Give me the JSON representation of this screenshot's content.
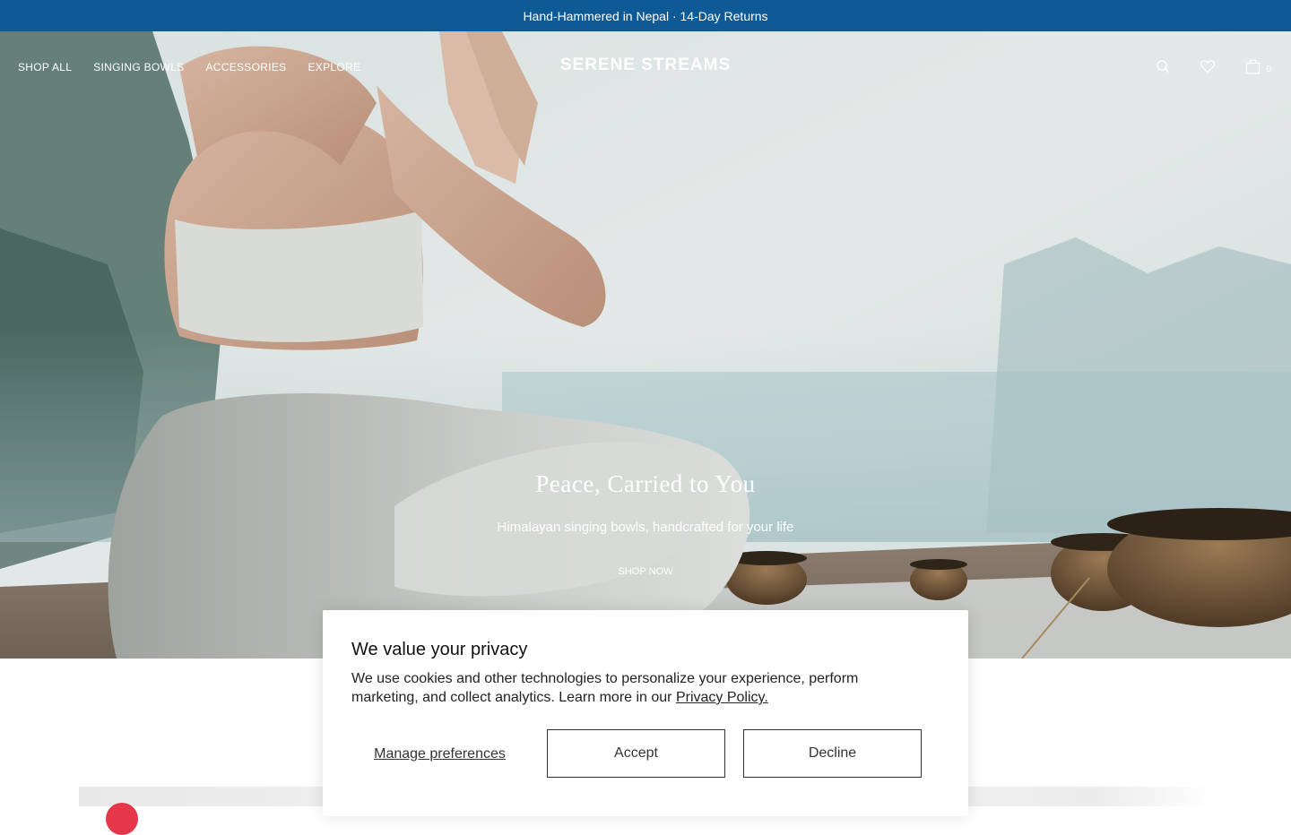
{
  "announcement": {
    "text": "Hand-Hammered in Nepal · 14-Day Returns"
  },
  "nav": {
    "links": [
      {
        "label": "SHOP ALL"
      },
      {
        "label": "SINGING BOWLS"
      },
      {
        "label": "ACCESSORIES"
      },
      {
        "label": "EXPLORE"
      }
    ],
    "logo": "SERENE STREAMS",
    "icons": [
      "search-icon",
      "heart-icon",
      "bag-icon"
    ],
    "cart_count": "0"
  },
  "hero": {
    "title": "Peace, Carried to You",
    "subtitle": "Himalayan singing bowls, handcrafted for your life",
    "cta": "SHOP NOW"
  },
  "cookie_modal": {
    "title": "We value your privacy",
    "text": "We use cookies and other technologies to personalize your experience, perform marketing, and collect analytics. Learn more in our ",
    "link": "Privacy Policy.",
    "manage": "Manage preferences",
    "accept": "Accept",
    "decline": "Decline"
  },
  "colors": {
    "announcement_bg": "#0d5a96",
    "text_dark": "#222222",
    "badge_red": "#e5364a"
  }
}
